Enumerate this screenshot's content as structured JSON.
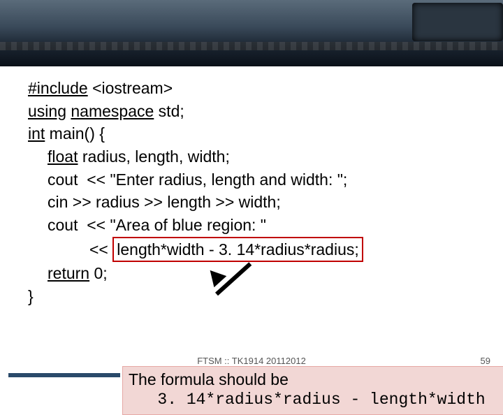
{
  "code": {
    "l1a": "#include",
    "l1b": " <iostream>",
    "l2a": "using",
    "l2b": " ",
    "l2c": "namespace",
    "l2d": " std;",
    "l3a": "int",
    "l3b": " main() {",
    "l4a": "float",
    "l4b": " radius, length, width;",
    "l5": "cout  << \"Enter radius, length and width: \";",
    "l6": "cin >> radius >> length >> width;",
    "l7": "cout  << \"Area of blue region: \"",
    "l8a": "<< ",
    "l8b": "length*width - 3. 14*radius*radius;",
    "l9a": "return",
    "l9b": " 0;",
    "l10": "}"
  },
  "callout": {
    "line1": "The formula should be",
    "line2": "   3. 14*radius*radius - length*width"
  },
  "footer": "FTSM :: TK1914 20112012",
  "slide_number": "59"
}
